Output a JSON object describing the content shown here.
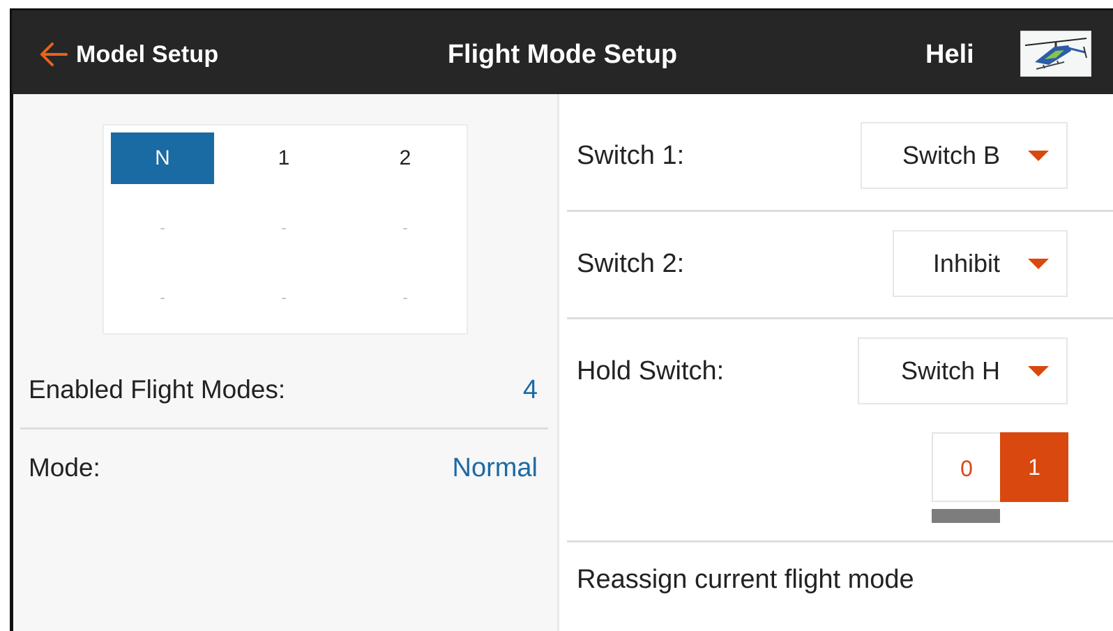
{
  "header": {
    "back_label": "Model Setup",
    "title": "Flight Mode Setup",
    "model_name": "Heli"
  },
  "flight_mode_grid": {
    "row1": [
      "N",
      "1",
      "2"
    ],
    "row2": [
      "-",
      "-",
      "-"
    ],
    "row3": [
      "-",
      "-",
      "-"
    ],
    "active": "N"
  },
  "left": {
    "enabled_label": "Enabled Flight Modes:",
    "enabled_value": "4",
    "mode_label": "Mode:",
    "mode_value": "Normal"
  },
  "right": {
    "switch1_label": "Switch 1:",
    "switch1_value": "Switch B",
    "switch2_label": "Switch 2:",
    "switch2_value": "Inhibit",
    "hold_label": "Hold Switch:",
    "hold_value": "Switch H",
    "hold_positions": [
      "0",
      "1"
    ],
    "hold_selected": "1",
    "reassign_label": "Reassign current flight mode"
  },
  "colors": {
    "accent_orange": "#d9480f",
    "accent_blue": "#1a6aa3",
    "header_bg": "#262626"
  }
}
